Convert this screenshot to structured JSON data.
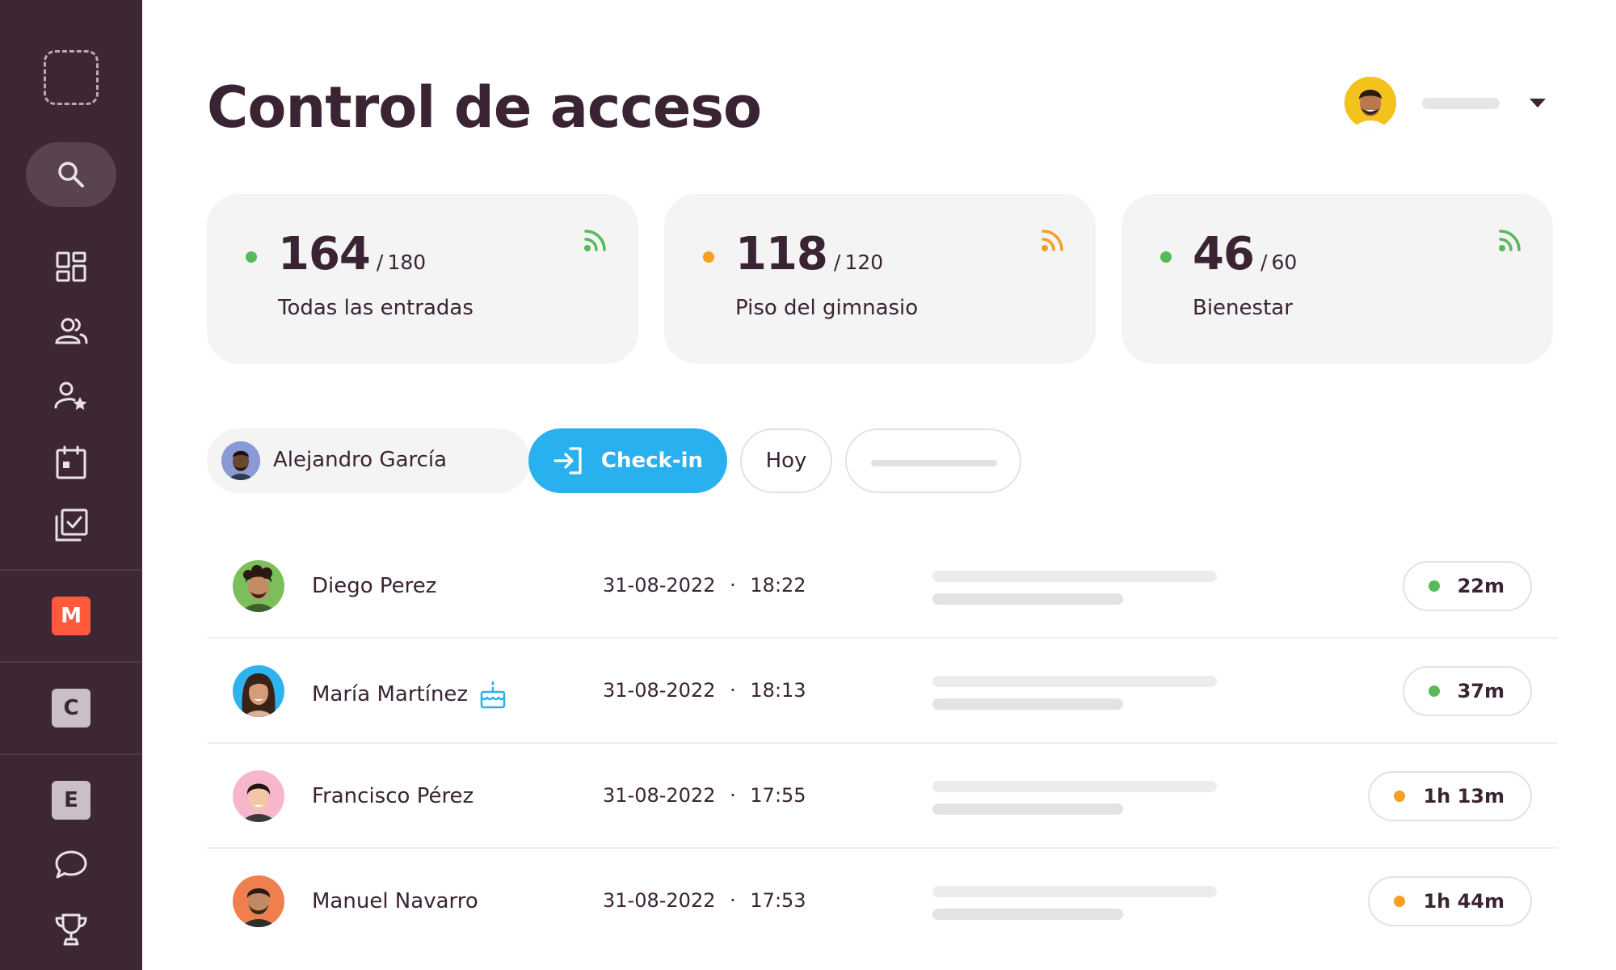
{
  "app": {
    "title": "Control de acceso"
  },
  "colors": {
    "sidebar": "#3d2734",
    "accent": "#28b1ee",
    "status_green": "#58b95a",
    "status_orange": "#f5a023",
    "text_dark": "#3a2433"
  },
  "sidebar": {
    "logo_icon": "logo-placeholder-icon",
    "items": [
      {
        "icon": "search-icon"
      },
      {
        "icon": "dashboard-icon"
      },
      {
        "icon": "members-icon"
      },
      {
        "icon": "member-star-icon"
      },
      {
        "icon": "calendar-icon"
      },
      {
        "icon": "checklist-icon"
      },
      {
        "icon": "chat-icon"
      },
      {
        "icon": "trophy-icon"
      }
    ],
    "workspaces": [
      "M",
      "C",
      "E"
    ]
  },
  "header": {
    "user_avatar_icon": "user-avatar",
    "dropdown_icon": "caret-down-icon"
  },
  "stats": [
    {
      "value": "164",
      "capacity": "180",
      "separator": "/",
      "label": "Todas las entradas",
      "status_color": "#58b95a",
      "feed_color": "#58b95a"
    },
    {
      "value": "118",
      "capacity": "120",
      "separator": "/",
      "label": "Piso del gimnasio",
      "status_color": "#f5a023",
      "feed_color": "#f5a023"
    },
    {
      "value": "46",
      "capacity": "60",
      "separator": "/",
      "label": "Bienestar",
      "status_color": "#58b95a",
      "feed_color": "#58b95a"
    }
  ],
  "filters": {
    "member_name": "Alejandro García",
    "checkin_label": "Check-in",
    "date_filter": "Hoy"
  },
  "checkins": [
    {
      "name": "Diego Perez",
      "date": "31-08-2022",
      "dot": "·",
      "time": "18:22",
      "duration": "22m",
      "status_color": "#58b95a",
      "birthday": false
    },
    {
      "name": "María Martínez",
      "date": "31-08-2022",
      "dot": "·",
      "time": "18:13",
      "duration": "37m",
      "status_color": "#58b95a",
      "birthday": true
    },
    {
      "name": "Francisco Pérez",
      "date": "31-08-2022",
      "dot": "·",
      "time": "17:55",
      "duration": "1h 13m",
      "status_color": "#f5a023",
      "birthday": false
    },
    {
      "name": "Manuel Navarro",
      "date": "31-08-2022",
      "dot": "·",
      "time": "17:53",
      "duration": "1h 44m",
      "status_color": "#f5a023",
      "birthday": false
    }
  ]
}
